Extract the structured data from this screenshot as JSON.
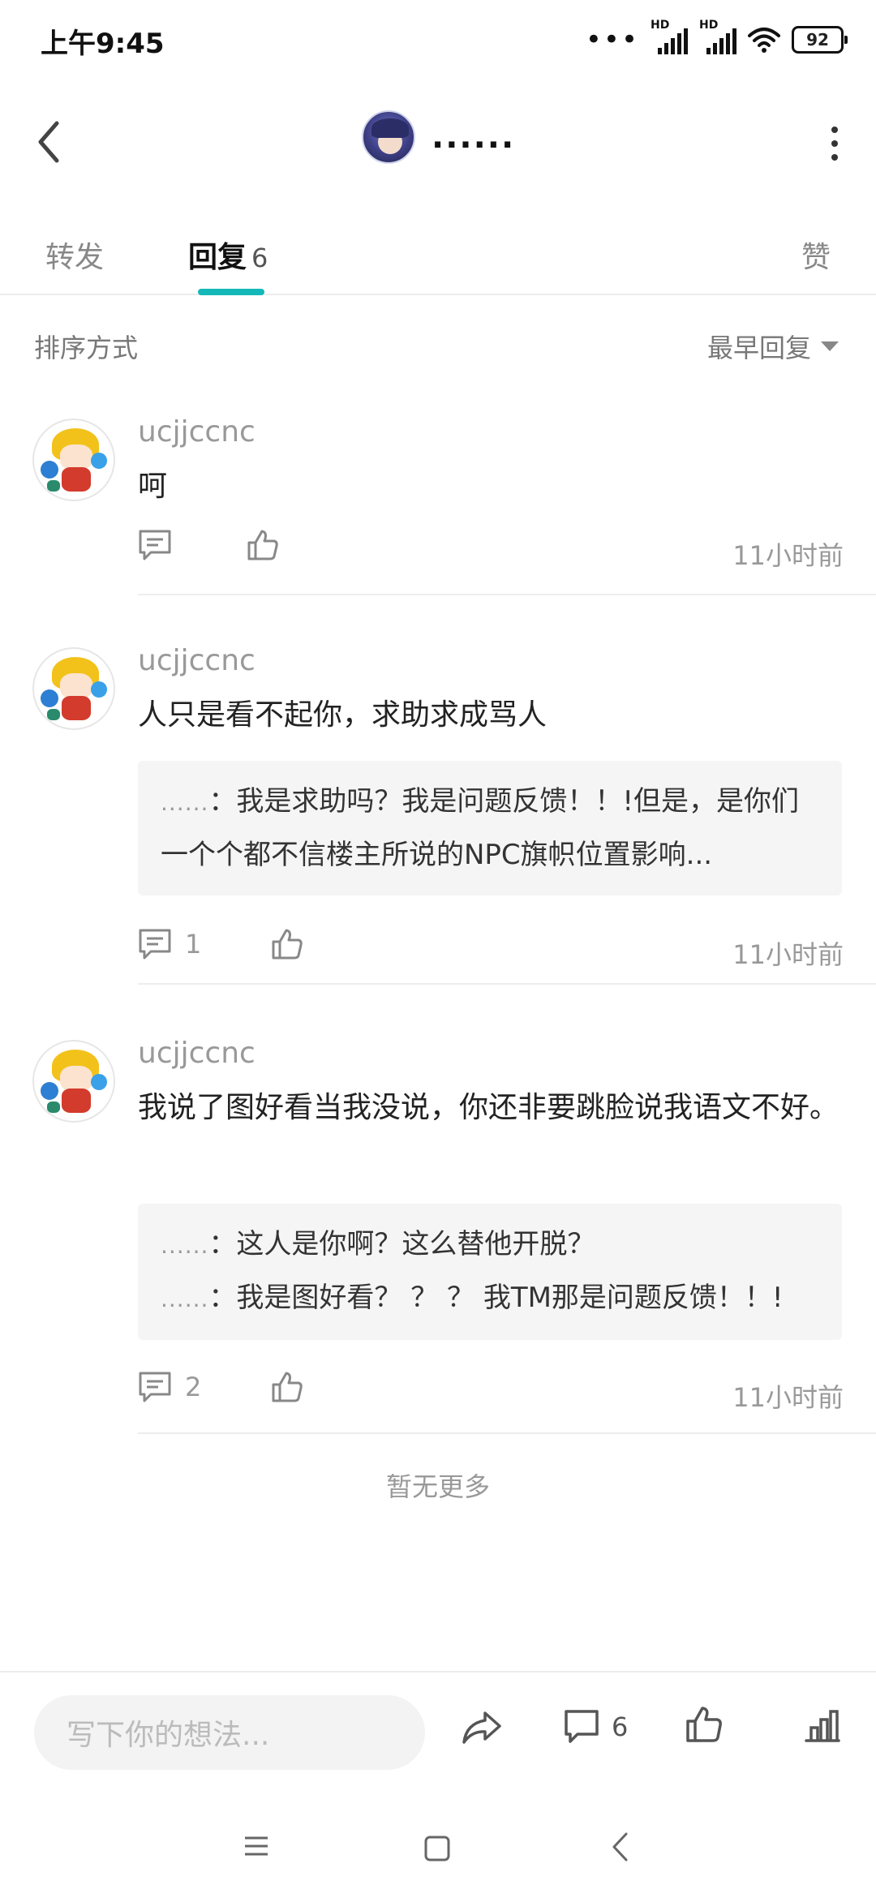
{
  "status_bar": {
    "time": "上午9:45",
    "signal_label_1": "HD",
    "signal_label_2": "HD",
    "battery": "92"
  },
  "header": {
    "title": "......",
    "back_icon": "chevron-left-icon",
    "more_icon": "more-vertical-icon"
  },
  "tabs": [
    {
      "label": "转发"
    },
    {
      "label": "回复",
      "count": "6"
    },
    {
      "label": "赞"
    }
  ],
  "accent_color": "#14b8b8",
  "sort": {
    "label": "排序方式",
    "selected": "最早回复"
  },
  "comments": [
    {
      "username": "ucjjccnc",
      "text": "呵",
      "reply_count": "",
      "time": "11小时前",
      "quotes": []
    },
    {
      "username": "ucjjccnc",
      "text": "人只是看不起你，求助求成骂人",
      "reply_count": "1",
      "time": "11小时前",
      "quotes": [
        {
          "name": "......",
          "text": "：我是求助吗？我是问题反馈！！!但是，是你们一个个都不信楼主所说的NPC旗帜位置影响..."
        }
      ]
    },
    {
      "username": "ucjjccnc",
      "text": "我说了图好看当我没说，你还非要跳脸说我语文不好。",
      "reply_count": "2",
      "time": "11小时前",
      "quotes": [
        {
          "name": "......",
          "text": "：这人是你啊？这么替他开脱？"
        },
        {
          "name": "......",
          "text": "：我是图好看？ ？ ？ 我TM那是问题反馈！！!"
        }
      ]
    }
  ],
  "no_more": "暂无更多",
  "bottom_bar": {
    "input_placeholder": "写下你的想法...",
    "comment_count": "6"
  }
}
